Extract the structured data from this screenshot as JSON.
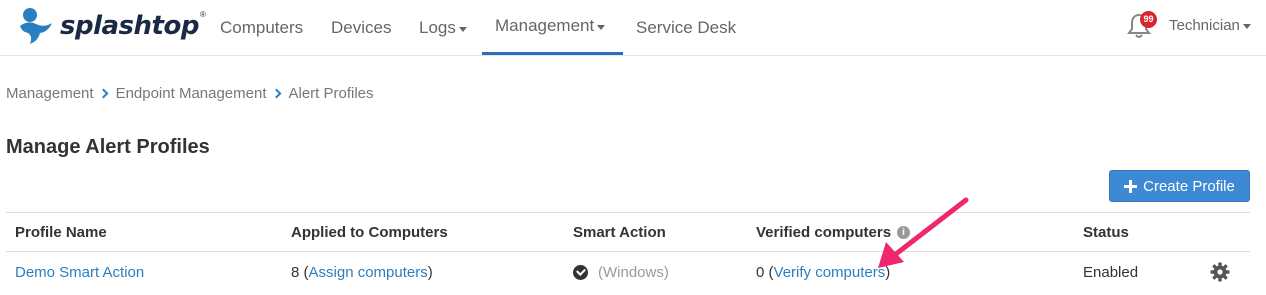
{
  "brand": {
    "name": "splashtop",
    "trademark": "®"
  },
  "nav": {
    "computers": "Computers",
    "devices": "Devices",
    "logs": "Logs",
    "management": "Management",
    "service_desk": "Service Desk",
    "notification_count": "99",
    "user": "Technician"
  },
  "breadcrumb": [
    "Management",
    "Endpoint Management",
    "Alert Profiles"
  ],
  "page": {
    "title": "Manage Alert Profiles",
    "create_button": "Create Profile"
  },
  "table": {
    "columns": [
      "Profile Name",
      "Applied to Computers",
      "Smart Action",
      "Verified computers",
      "Status"
    ],
    "rows": [
      {
        "profile_name": "Demo Smart Action",
        "applied_count": "8",
        "assign_link": "Assign computers",
        "smart_action": "(Windows)",
        "verified_count": "0",
        "verify_link": "Verify computers",
        "status": "Enabled"
      }
    ]
  },
  "colors": {
    "accent": "#2a7fc1",
    "button": "#3d89d4",
    "badge": "#d9262c",
    "annotation_arrow": "#f0266e"
  },
  "icons": [
    "splashtop-logo-icon",
    "bell-icon",
    "plus-icon",
    "check-circle-icon",
    "info-icon",
    "gear-icon"
  ]
}
